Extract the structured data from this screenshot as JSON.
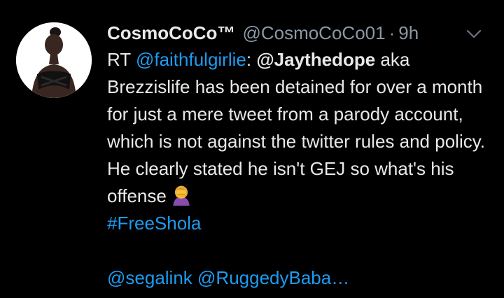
{
  "tweet": {
    "display_name": "CosmoCoCo™",
    "handle": "@CosmoCoCo01",
    "separator": "·",
    "time": "9h",
    "rt_prefix": "RT",
    "rt_user": "@faithfulgirlie",
    "colon": ":",
    "mention_main": "@Jaythedope",
    "text_main": " aka Brezzislife has been detained for over a month for just a mere tweet from a parody account, which is not against the twitter rules and policy. He clearly stated he isn't GEJ so what's his offense",
    "emoji": "woman-facepalming-icon",
    "hashtag": "#FreeShola",
    "mention_1": "@segalink",
    "mention_2": "@RuggedyBaba…"
  },
  "colors": {
    "background": "#000000",
    "text": "#e7e9ea",
    "muted": "#8b98a5",
    "link": "#1d9bf0"
  }
}
